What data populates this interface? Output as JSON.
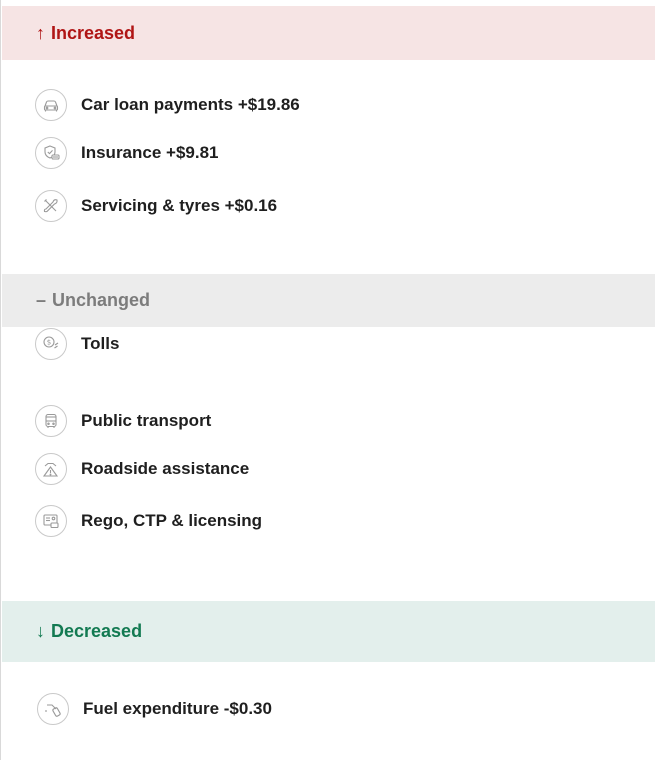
{
  "sections": {
    "increased": {
      "arrow": "↑",
      "title": "Increased",
      "color": "#b01515",
      "background": "#f6e4e4",
      "items": [
        {
          "icon": "car-icon",
          "label": "Car loan payments +$19.86"
        },
        {
          "icon": "shield-car-icon",
          "label": "Insurance +$9.81"
        },
        {
          "icon": "tools-icon",
          "label": "Servicing & tyres +$0.16"
        }
      ]
    },
    "unchanged": {
      "arrow": "–",
      "title": "Unchanged",
      "color": "#7c7c7c",
      "background": "#ececec",
      "items": [
        {
          "icon": "toll-icon",
          "label": "Tolls"
        },
        {
          "icon": "bus-icon",
          "label": "Public transport"
        },
        {
          "icon": "roadside-warning-icon",
          "label": "Roadside assistance"
        },
        {
          "icon": "license-card-icon",
          "label": "Rego, CTP & licensing"
        }
      ]
    },
    "decreased": {
      "arrow": "↓",
      "title": "Decreased",
      "color": "#137a52",
      "background": "#e3efec",
      "items": [
        {
          "icon": "fuel-nozzle-icon",
          "label": "Fuel expenditure -$0.30"
        }
      ]
    }
  }
}
